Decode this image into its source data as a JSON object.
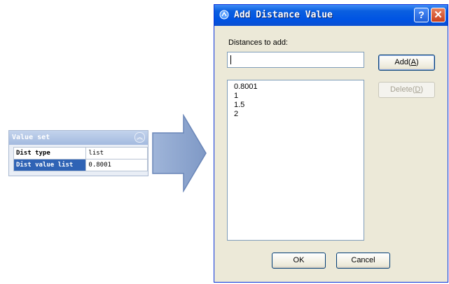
{
  "panel": {
    "title": "Value set",
    "rows": [
      {
        "key": "Dist type",
        "value": "list"
      },
      {
        "key": "Dist value list",
        "value": "0.8001"
      }
    ]
  },
  "dialog": {
    "title": "Add Distance Value",
    "help_label": "?",
    "close_label": "✕",
    "distances_label": "Distances to add:",
    "input_value": "",
    "add_button": {
      "label": "Add(",
      "mnemonic": "A",
      "suffix": ")"
    },
    "delete_button": {
      "label": "Delete(",
      "mnemonic": "D",
      "suffix": ")"
    },
    "list_items": [
      "0.8001",
      "1",
      "1.5",
      "2"
    ],
    "ok_label": "OK",
    "cancel_label": "Cancel"
  },
  "colors": {
    "titlebar": "#0054e3",
    "selected_row": "#2f63b5",
    "arrow_fill": "#8ea6ce"
  }
}
